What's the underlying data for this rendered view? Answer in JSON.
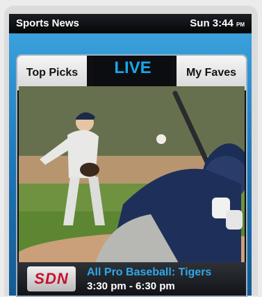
{
  "statusbar": {
    "app_name": "Sports News",
    "day_time": "Sun 3:44",
    "ampm": "PM"
  },
  "tabs": {
    "left": "Top Picks",
    "center": "LIVE",
    "right": "My Faves"
  },
  "program": {
    "channel_logo": "SDN",
    "title": "All Pro Baseball: Tigers",
    "time_range": "3:30 pm - 6:30 pm"
  },
  "colors": {
    "accent": "#2ea8ea",
    "frame": "#1b6fae",
    "logo_red": "#c8102e"
  },
  "video": {
    "icon": "baseball-broadcast-image"
  }
}
